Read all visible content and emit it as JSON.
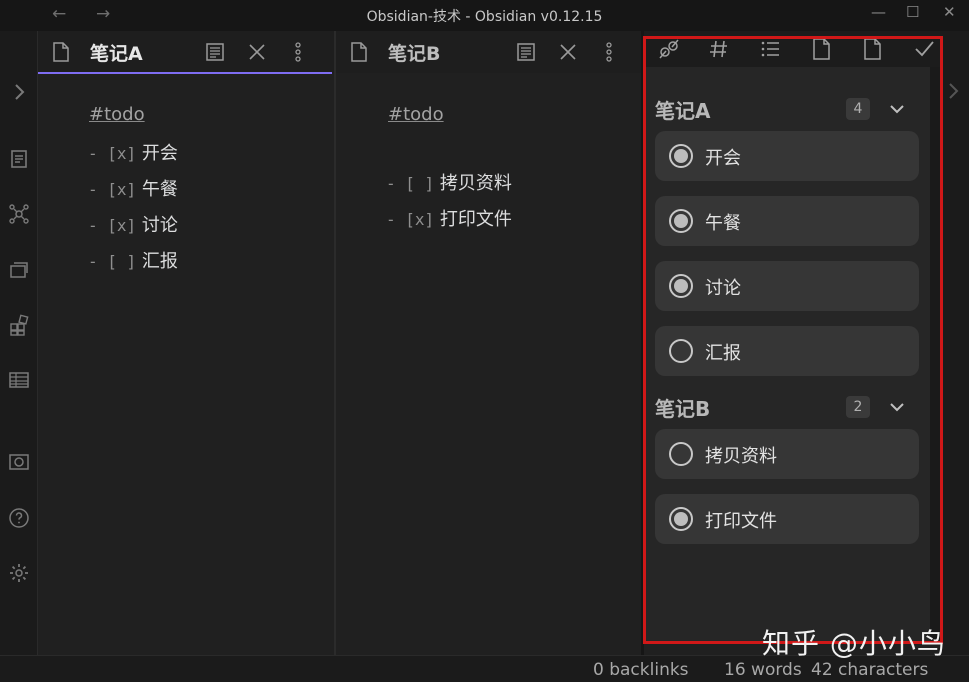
{
  "window": {
    "title": "Obsidian-技术 - Obsidian v0.12.15",
    "back_icon": "←",
    "forward_icon": "→",
    "minimize": "—",
    "maximize": "☐",
    "close": "✕"
  },
  "ribbon": {
    "expand_icon": "›",
    "icons": [
      "open-quick-switcher-icon",
      "graph-view-icon",
      "open-slides-icon",
      "kanban-icon",
      "table-icon",
      "camera-icon",
      "help-icon",
      "settings-icon"
    ]
  },
  "pane_a": {
    "title": "笔记A",
    "tag": "#todo",
    "lines": [
      {
        "mark": "- [x]",
        "text": "开会"
      },
      {
        "mark": "- [x]",
        "text": "午餐"
      },
      {
        "mark": "- [x]",
        "text": "讨论"
      },
      {
        "mark": "- [ ]",
        "text": "汇报"
      }
    ]
  },
  "pane_b": {
    "title": "笔记B",
    "tag": "#todo",
    "lines": [
      {
        "mark": "- [ ]",
        "text": "拷贝资料"
      },
      {
        "mark": "- [x]",
        "text": "打印文件"
      }
    ]
  },
  "todo_panel": {
    "groups": [
      {
        "title": "笔记A",
        "count": "4",
        "items": [
          {
            "label": "开会",
            "checked": true
          },
          {
            "label": "午餐",
            "checked": true
          },
          {
            "label": "讨论",
            "checked": true
          },
          {
            "label": "汇报",
            "checked": false
          }
        ]
      },
      {
        "title": "笔记B",
        "count": "2",
        "items": [
          {
            "label": "拷贝资料",
            "checked": false
          },
          {
            "label": "打印文件",
            "checked": true
          }
        ]
      }
    ]
  },
  "status": {
    "backlinks": "0 backlinks",
    "words": "16 words",
    "characters": "42 characters"
  },
  "watermark": "知乎 @小小鸟",
  "colors": {
    "accent": "#7f6df2",
    "highlight_frame": "#d01818"
  }
}
